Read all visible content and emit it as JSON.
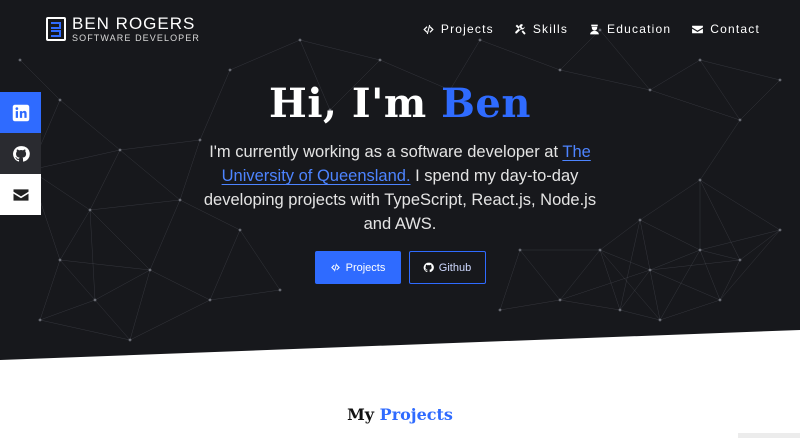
{
  "brand": {
    "name": "BEN ROGERS",
    "subtitle": "SOFTWARE DEVELOPER"
  },
  "nav": {
    "items": [
      {
        "label": "Projects",
        "icon": "code-icon"
      },
      {
        "label": "Skills",
        "icon": "tools-icon"
      },
      {
        "label": "Education",
        "icon": "graduate-icon"
      },
      {
        "label": "Contact",
        "icon": "envelope-icon"
      }
    ]
  },
  "social": [
    {
      "name": "linkedin",
      "icon": "linkedin-icon"
    },
    {
      "name": "github",
      "icon": "github-icon"
    },
    {
      "name": "email",
      "icon": "envelope-icon"
    }
  ],
  "hero": {
    "greeting": "Hi, I'm",
    "name": "Ben",
    "intro_before": "I'm currently working as a software developer at",
    "intro_link": "The University of Queensland.",
    "intro_after": "I spend my day-to-day developing projects with TypeScript, React.js, Node.js and AWS.",
    "buttons": {
      "projects": "Projects",
      "github": "Github"
    }
  },
  "section": {
    "title_prefix": "My",
    "title_accent": "Projects"
  },
  "colors": {
    "accent": "#2f6bff",
    "hero_bg": "#17181c",
    "github_tile": "#2a2b30"
  }
}
